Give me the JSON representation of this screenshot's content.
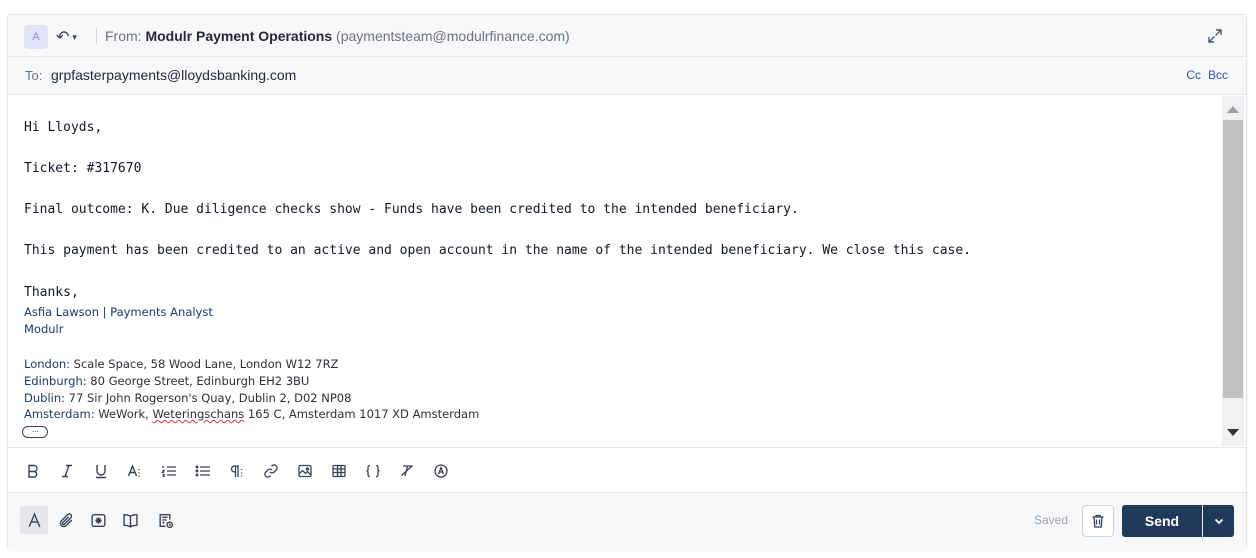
{
  "header": {
    "avatar_letter": "A",
    "from_label": "From:",
    "from_name": "Modulr Payment Operations",
    "from_email": "(paymentsteam@modulrfinance.com)"
  },
  "recipients": {
    "to_label": "To:",
    "to_value": "grpfasterpayments@lloydsbanking.com",
    "cc_label": "Cc",
    "bcc_label": "Bcc"
  },
  "body": {
    "greeting": "Hi Lloyds,",
    "ticket": "Ticket: #317670",
    "outcome": "Final outcome: K. Due diligence checks show - Funds have been credited to the intended beneficiary.",
    "details": "This payment has been credited to an active and open account in the name of the intended beneficiary. We close this case.",
    "thanks": "Thanks,",
    "sig_name": "Asfia Lawson |  Payments Analyst",
    "sig_company": "Modulr",
    "london_label": "London:",
    "london_addr": " Scale Space, 58 Wood Lane, London W12 7RZ",
    "edinburgh_label": "Edinburgh:",
    "edinburgh_addr": " 80 George Street, Edinburgh EH2 3BU",
    "dublin_label": "Dublin:",
    "dublin_addr": " 77 Sir John Rogerson's Quay, Dublin 2, D02 NP08",
    "amsterdam_label": "Amsterdam:",
    "amsterdam_pre": " WeWork, ",
    "amsterdam_misspelled": "Weteringschans",
    "amsterdam_post": " 165 C, Amsterdam 1017 XD Amsterdam",
    "more_label": "···"
  },
  "footer": {
    "saved_label": "Saved",
    "send_label": "Send"
  },
  "icons": {
    "format_bar": [
      "bold-icon",
      "italic-icon",
      "underline-icon",
      "font-size-icon",
      "ordered-list-icon",
      "bullet-list-icon",
      "paragraph-icon",
      "link-icon",
      "image-icon",
      "table-icon",
      "code-icon",
      "clear-format-icon",
      "signature-icon"
    ],
    "action_bar": [
      "text-format-icon",
      "attachment-icon",
      "insert-snippet-icon",
      "knowledge-base-icon",
      "template-icon",
      "trash-icon",
      "chevron-down-icon"
    ]
  },
  "colors": {
    "send_button": "#1f3a5a",
    "link_blue": "#2f5aa8",
    "signature_blue": "#1f3a66"
  }
}
